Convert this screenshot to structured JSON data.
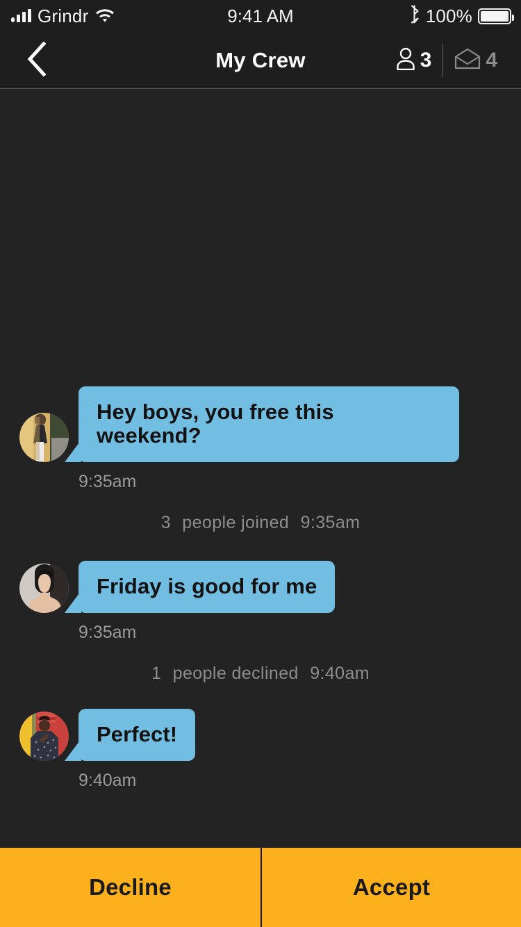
{
  "status_bar": {
    "carrier": "Grindr",
    "time": "9:41 AM",
    "battery_percent": "100%",
    "icons": [
      "signal-bars-icon",
      "wifi-icon",
      "bluetooth-icon",
      "battery-icon"
    ]
  },
  "nav": {
    "back_icon": "chevron-left-icon",
    "title": "My Crew",
    "members": {
      "icon": "person-icon",
      "count": "3"
    },
    "invites": {
      "icon": "envelope-open-icon",
      "count": "4"
    }
  },
  "chat": {
    "messages": [
      {
        "type": "message",
        "avatar": "avatar-yellow-wall",
        "text": "Hey boys, you free this weekend?",
        "time": "9:35am"
      },
      {
        "type": "system",
        "count": "3",
        "label": "people joined",
        "time": "9:35am"
      },
      {
        "type": "message",
        "avatar": "avatar-dark-hair",
        "text": "Friday is good for me",
        "time": "9:35am"
      },
      {
        "type": "system",
        "count": "1",
        "label": "people declined",
        "time": "9:40am"
      },
      {
        "type": "message",
        "avatar": "avatar-red-yellow-wall",
        "text": "Perfect!",
        "time": "9:40am"
      }
    ]
  },
  "actions": {
    "decline_label": "Decline",
    "accept_label": "Accept"
  },
  "colors": {
    "background": "#232323",
    "navbar": "#1e1e1e",
    "bubble": "#72bee3",
    "bubble_text": "#121212",
    "accent_orange": "#fbb01c",
    "timestamp": "#9a9a9a",
    "system_text": "#8d8d8d"
  }
}
